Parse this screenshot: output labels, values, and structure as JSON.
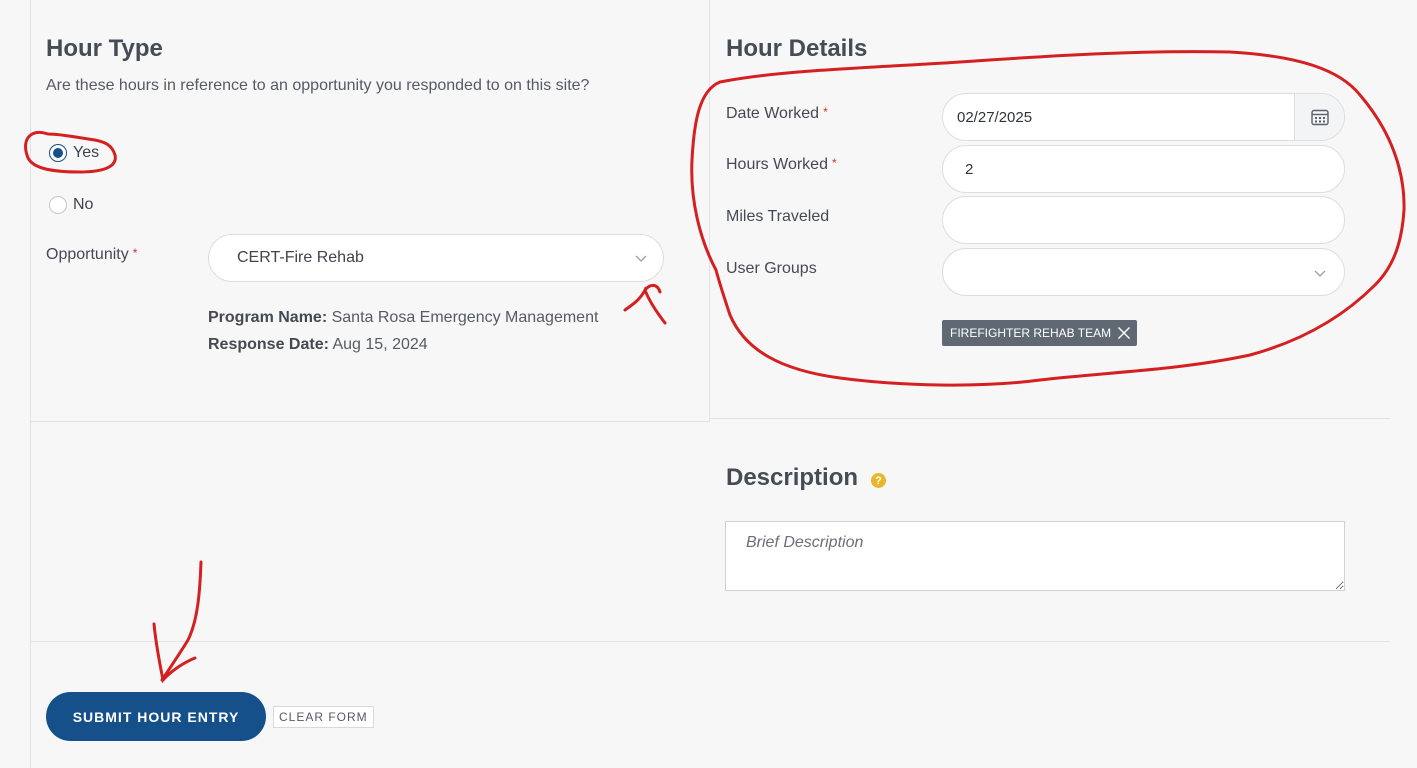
{
  "hour_type": {
    "title": "Hour Type",
    "question": "Are these hours in reference to an opportunity you responded to on this site?",
    "options": [
      {
        "label": "Yes",
        "selected": true
      },
      {
        "label": "No",
        "selected": false
      }
    ],
    "opportunity_label": "Opportunity",
    "required_mark": "*",
    "opportunity_value": "CERT-Fire Rehab",
    "program_name_label": "Program Name:",
    "program_name_value": "Santa Rosa Emergency Management",
    "response_date_label": "Response Date:",
    "response_date_value": "Aug 15, 2024"
  },
  "hour_details": {
    "title": "Hour Details",
    "date_worked_label": "Date Worked",
    "date_worked_value": "02/27/2025",
    "hours_worked_label": "Hours Worked",
    "hours_worked_value": "2",
    "miles_traveled_label": "Miles Traveled",
    "miles_traveled_value": "",
    "user_groups_label": "User Groups",
    "user_groups_selected": [
      "FIREFIGHTER REHAB TEAM"
    ]
  },
  "description": {
    "title": "Description",
    "help_icon": "?",
    "placeholder": "Brief Description"
  },
  "actions": {
    "submit_label": "SUBMIT HOUR ENTRY",
    "clear_label": "CLEAR FORM"
  },
  "colors": {
    "primary": "#15508a",
    "required": "#d0302f",
    "help": "#e8b82b",
    "tag": "#5f6873",
    "annotation": "#d42020"
  }
}
